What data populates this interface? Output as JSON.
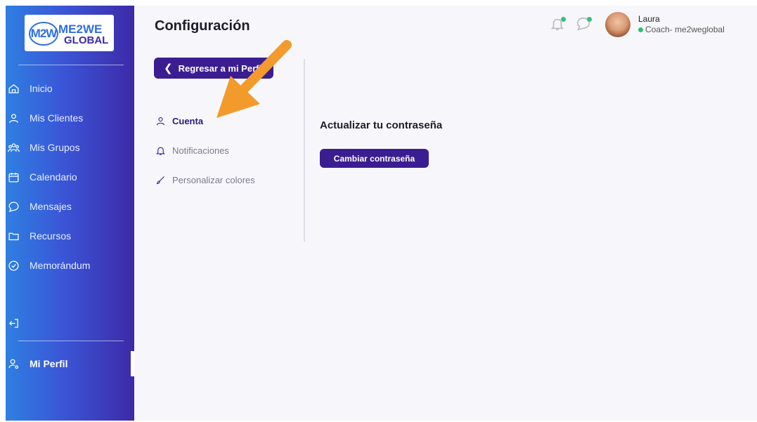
{
  "sidebar": {
    "logo": {
      "mark": "M2W",
      "line1": "ME2WE",
      "line2": "GLOBAL"
    },
    "items": [
      {
        "label": "Inicio",
        "icon": "home-icon"
      },
      {
        "label": "Mis Clientes",
        "icon": "user-icon"
      },
      {
        "label": "Mis Grupos",
        "icon": "group-icon"
      },
      {
        "label": "Calendario",
        "icon": "calendar-icon"
      },
      {
        "label": "Mensajes",
        "icon": "chat-bubble-icon"
      },
      {
        "label": "Recursos",
        "icon": "folder-icon"
      },
      {
        "label": "Memorándum",
        "icon": "check-circle-icon"
      }
    ],
    "logout_icon": "logout-icon",
    "profile": {
      "label": "Mi Perfil",
      "icon": "user-settings-icon"
    }
  },
  "header": {
    "title": "Configuración",
    "notifications_icon": "bell-icon",
    "messages_icon": "chat-bubble-icon",
    "user": {
      "name": "Laura",
      "role": "Coach- me2weglobal",
      "status_color": "#2fbf71"
    }
  },
  "settings_nav": {
    "back_label": "Regresar a mi Perfil",
    "items": [
      {
        "label": "Cuenta",
        "icon": "user-icon",
        "active": true
      },
      {
        "label": "Notificaciones",
        "icon": "bell-icon",
        "active": false
      },
      {
        "label": "Personalizar colores",
        "icon": "brush-icon",
        "active": false
      }
    ]
  },
  "content": {
    "section_title": "Actualizar tu contraseña",
    "change_password_label": "Cambiar contraseña"
  },
  "colors": {
    "primary": "#3b1d92",
    "sidebar_gradient_start": "#2f7fe2",
    "sidebar_gradient_end": "#3d2aa8",
    "annotation_arrow": "#f39a2d"
  }
}
